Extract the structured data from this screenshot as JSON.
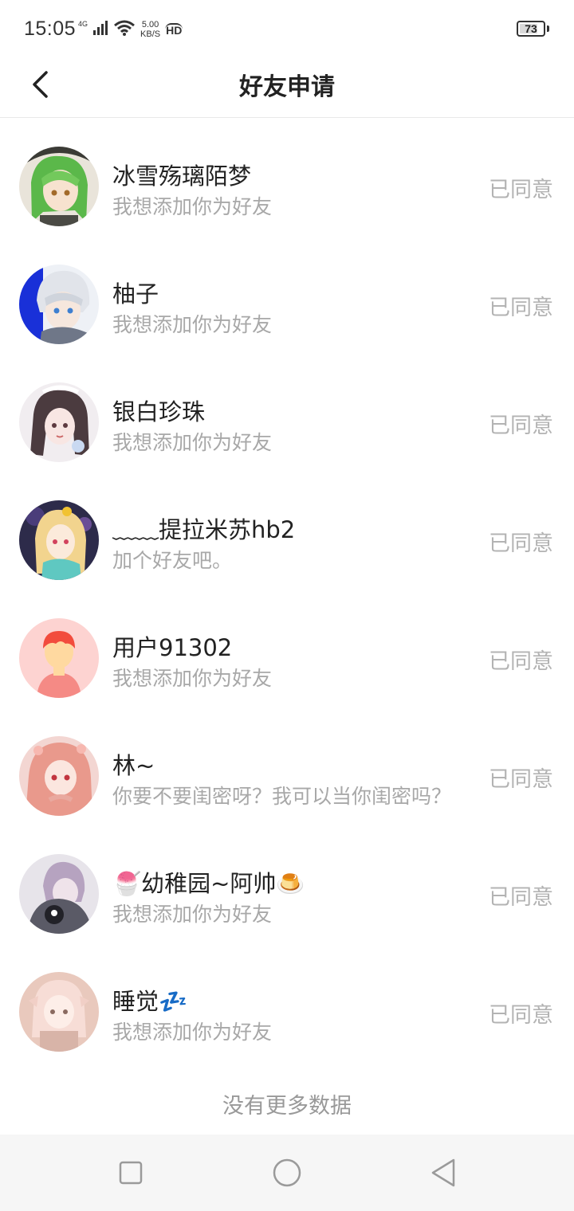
{
  "status_bar": {
    "time": "15:05",
    "network": "4G",
    "speed_value": "5.00",
    "speed_unit": "KB/S",
    "hd": "HD",
    "battery": "73"
  },
  "header": {
    "title": "好友申请"
  },
  "requests": [
    {
      "name": "冰雪殇璃陌梦",
      "message": "我想添加你为好友",
      "status": "已同意"
    },
    {
      "name": "柚子",
      "message": "我想添加你为好友",
      "status": "已同意"
    },
    {
      "name": "银白珍珠",
      "message": "我想添加你为好友",
      "status": "已同意"
    },
    {
      "name": "﹏﹏提拉米苏hb2",
      "message": "加个好友吧。",
      "status": "已同意"
    },
    {
      "name": "用户91302",
      "message": "我想添加你为好友",
      "status": "已同意"
    },
    {
      "name": "林~",
      "message": "你要不要闺密呀？我可以当你闺密吗？",
      "status": "已同意"
    },
    {
      "name": "🍧幼稚园~阿帅🍮",
      "message": "我想添加你为好友",
      "status": "已同意"
    },
    {
      "name": "睡觉💤",
      "message": "我想添加你为好友",
      "status": "已同意"
    }
  ],
  "footer": {
    "no_more": "没有更多数据"
  },
  "colors": {
    "accent_text": "#222222",
    "secondary_text": "#a8a8a8",
    "status_text": "#b3b3b3",
    "nav_bg": "#f6f6f6"
  },
  "icons": {
    "back": "chevron-left-icon",
    "nav_recent": "square-icon",
    "nav_home": "circle-icon",
    "nav_back": "triangle-back-icon"
  }
}
